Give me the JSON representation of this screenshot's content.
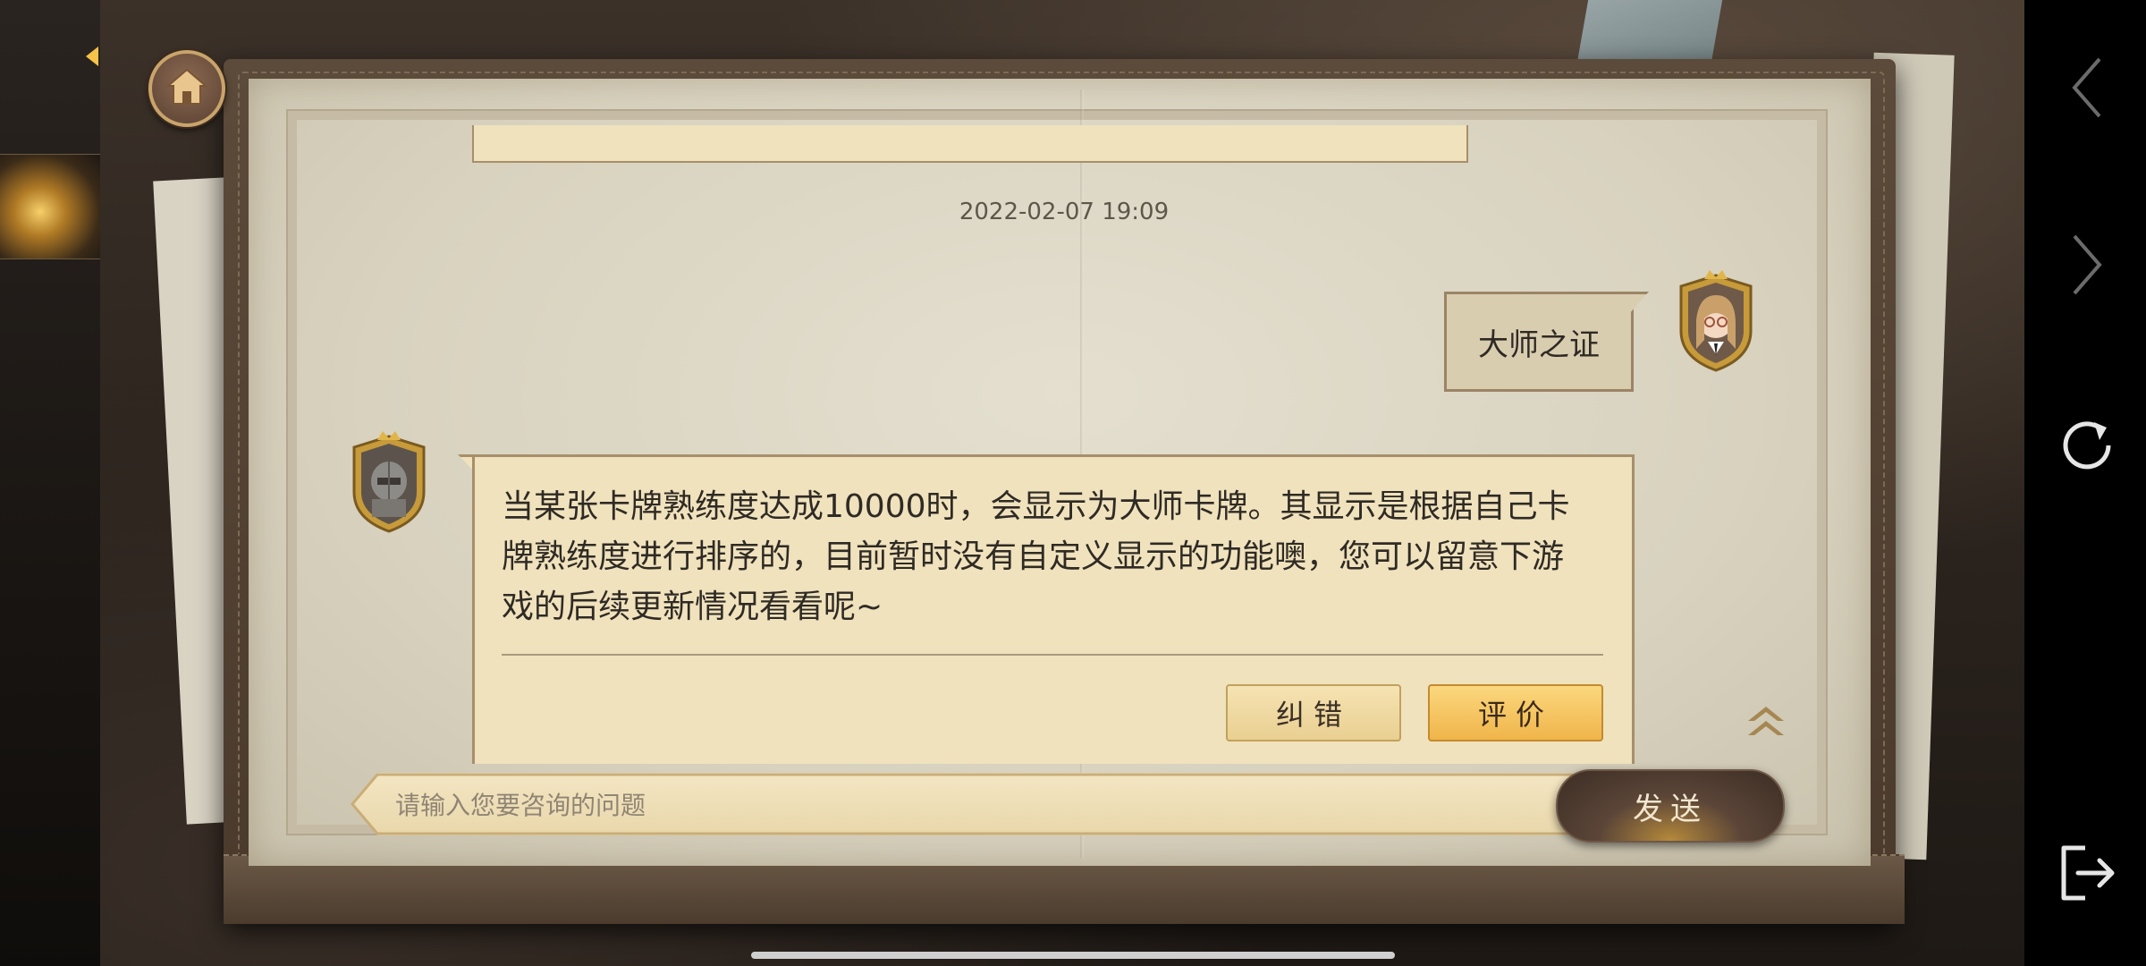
{
  "chat": {
    "timestamp": "2022-02-07 19:09",
    "user_message": "大师之证",
    "bot_message": "当某张卡牌熟练度达成10000时，会显示为大师卡牌。其显示是根据自己卡\n牌熟练度进行排序的，目前暂时没有自定义显示的功能噢，您可以留意下游\n戏的后续更新情况看看呢~",
    "correct_button": "纠错",
    "rate_button": "评价"
  },
  "input": {
    "placeholder": "请输入您要咨询的问题",
    "value": "",
    "send_button": "发送"
  },
  "icons": {
    "home": "home-icon",
    "scroll_top": "double-chevron-up-icon",
    "nav_back": "chevron-left-icon",
    "nav_forward": "chevron-right-icon",
    "refresh": "refresh-icon",
    "exit": "exit-icon"
  },
  "colors": {
    "paper": "#e4dfcf",
    "bubble": "#efe2bd",
    "rate_button": "#f0b54a",
    "send_button": "#3c2d24"
  }
}
